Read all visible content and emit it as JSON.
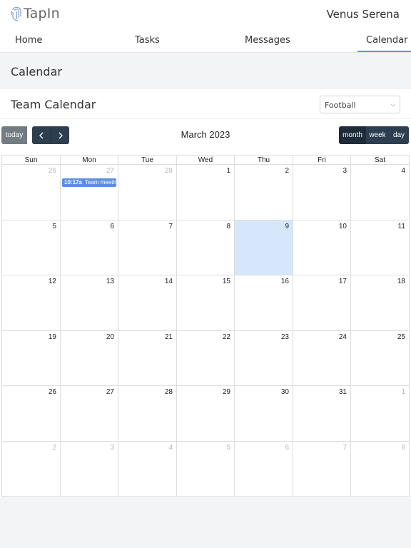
{
  "app": {
    "logo_text": "TapIn",
    "user_name": "Venus Serena"
  },
  "nav": {
    "tabs": [
      {
        "label": "Home"
      },
      {
        "label": "Tasks"
      },
      {
        "label": "Messages"
      },
      {
        "label": "Calendar",
        "active": true
      }
    ]
  },
  "page": {
    "title": "Calendar"
  },
  "team_calendar": {
    "title": "Team Calendar",
    "team_select": {
      "value": "Football"
    }
  },
  "toolbar": {
    "today_label": "today",
    "prev_label": "‹",
    "next_label": "›",
    "title": "March 2023",
    "views": [
      {
        "label": "month",
        "active": true
      },
      {
        "label": "week"
      },
      {
        "label": "day"
      }
    ]
  },
  "calendar": {
    "weekdays": [
      "Sun",
      "Mon",
      "Tue",
      "Wed",
      "Thu",
      "Fri",
      "Sat"
    ],
    "weeks": [
      [
        {
          "d": "26",
          "other": true
        },
        {
          "d": "27",
          "other": true
        },
        {
          "d": "28",
          "other": true
        },
        {
          "d": "1"
        },
        {
          "d": "2"
        },
        {
          "d": "3"
        },
        {
          "d": "4"
        }
      ],
      [
        {
          "d": "5"
        },
        {
          "d": "6"
        },
        {
          "d": "7"
        },
        {
          "d": "8"
        },
        {
          "d": "9",
          "today": true
        },
        {
          "d": "10"
        },
        {
          "d": "11"
        }
      ],
      [
        {
          "d": "12"
        },
        {
          "d": "13"
        },
        {
          "d": "14"
        },
        {
          "d": "15"
        },
        {
          "d": "16"
        },
        {
          "d": "17"
        },
        {
          "d": "18"
        }
      ],
      [
        {
          "d": "19"
        },
        {
          "d": "20"
        },
        {
          "d": "21"
        },
        {
          "d": "22"
        },
        {
          "d": "23"
        },
        {
          "d": "24"
        },
        {
          "d": "25"
        }
      ],
      [
        {
          "d": "26"
        },
        {
          "d": "27"
        },
        {
          "d": "28"
        },
        {
          "d": "29"
        },
        {
          "d": "30"
        },
        {
          "d": "31"
        },
        {
          "d": "1",
          "other": true
        }
      ],
      [
        {
          "d": "2",
          "other": true
        },
        {
          "d": "3",
          "other": true
        },
        {
          "d": "4",
          "other": true
        },
        {
          "d": "5",
          "other": true
        },
        {
          "d": "6",
          "other": true
        },
        {
          "d": "7",
          "other": true
        },
        {
          "d": "8",
          "other": true
        }
      ]
    ],
    "events": [
      {
        "week": 0,
        "day": 1,
        "time": "10:17a",
        "title": "Team meeting"
      }
    ],
    "colors": {
      "event": "#5b8fe3",
      "today": "#d6e6fb"
    }
  }
}
